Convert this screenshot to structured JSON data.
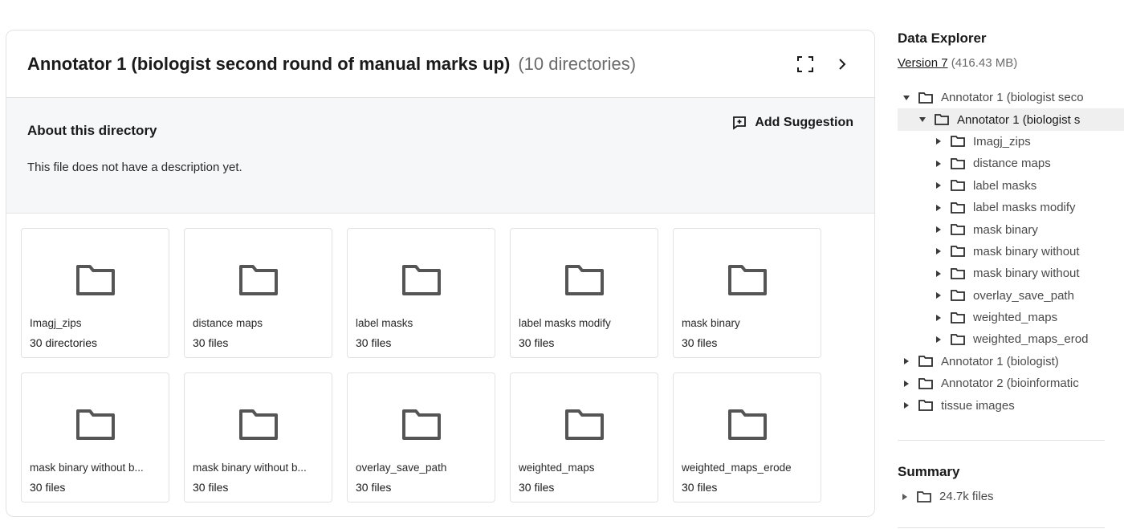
{
  "header": {
    "title": "Annotator 1 (biologist second round of manual marks up)",
    "count": "(10 directories)",
    "expand_icon": "fullscreen-icon",
    "next_icon": "chevron-right-icon"
  },
  "about": {
    "title": "About this directory",
    "description": "This file does not have a description yet.",
    "suggest_label": "Add Suggestion"
  },
  "tiles": [
    {
      "name": "Imagj_zips",
      "count": "30 directories"
    },
    {
      "name": "distance maps",
      "count": "30 files"
    },
    {
      "name": "label masks",
      "count": "30 files"
    },
    {
      "name": "label masks modify",
      "count": "30 files"
    },
    {
      "name": "mask binary",
      "count": "30 files"
    },
    {
      "name": "mask binary without b...",
      "count": "30 files"
    },
    {
      "name": "mask binary without b...",
      "count": "30 files"
    },
    {
      "name": "overlay_save_path",
      "count": "30 files"
    },
    {
      "name": "weighted_maps",
      "count": "30 files"
    },
    {
      "name": "weighted_maps_erode",
      "count": "30 files"
    }
  ],
  "explorer": {
    "title": "Data Explorer",
    "version_link": "Version 7",
    "version_size": "(416.43 MB)",
    "tree": [
      {
        "label": "Annotator 1 (biologist seco",
        "level": 0,
        "open": true,
        "selected": false
      },
      {
        "label": "Annotator 1 (biologist s",
        "level": 1,
        "open": true,
        "selected": true
      },
      {
        "label": "Imagj_zips",
        "level": 2,
        "open": false,
        "selected": false
      },
      {
        "label": "distance maps",
        "level": 2,
        "open": false,
        "selected": false
      },
      {
        "label": "label masks",
        "level": 2,
        "open": false,
        "selected": false
      },
      {
        "label": "label masks modify",
        "level": 2,
        "open": false,
        "selected": false
      },
      {
        "label": "mask binary",
        "level": 2,
        "open": false,
        "selected": false
      },
      {
        "label": "mask binary without",
        "level": 2,
        "open": false,
        "selected": false
      },
      {
        "label": "mask binary without",
        "level": 2,
        "open": false,
        "selected": false
      },
      {
        "label": "overlay_save_path",
        "level": 2,
        "open": false,
        "selected": false
      },
      {
        "label": "weighted_maps",
        "level": 2,
        "open": false,
        "selected": false
      },
      {
        "label": "weighted_maps_erod",
        "level": 2,
        "open": false,
        "selected": false
      },
      {
        "label": "Annotator 1 (biologist)",
        "level": 0,
        "open": false,
        "selected": false
      },
      {
        "label": "Annotator 2 (bioinformatic",
        "level": 0,
        "open": false,
        "selected": false
      },
      {
        "label": "tissue images",
        "level": 0,
        "open": false,
        "selected": false
      }
    ]
  },
  "summary": {
    "title": "Summary",
    "row_label": "24.7k files"
  }
}
